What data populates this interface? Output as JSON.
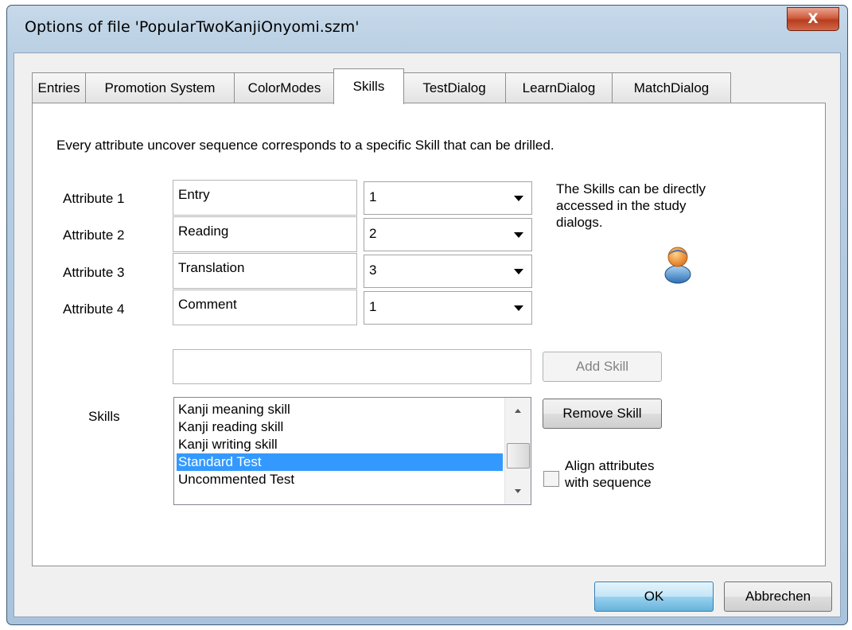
{
  "window": {
    "title": "Options of file 'PopularTwoKanjiOnyomi.szm'",
    "close_symbol": "X"
  },
  "tabs": [
    {
      "label": "Entries"
    },
    {
      "label": "Promotion System"
    },
    {
      "label": "ColorModes"
    },
    {
      "label": "Skills",
      "active": true
    },
    {
      "label": "TestDialog"
    },
    {
      "label": "LearnDialog"
    },
    {
      "label": "MatchDialog"
    }
  ],
  "skills_tab": {
    "intro": "Every attribute uncover sequence corresponds to a specific Skill that can be drilled.",
    "attributes": [
      {
        "label": "Attribute 1",
        "name": "Entry",
        "sequence": "1"
      },
      {
        "label": "Attribute 2",
        "name": "Reading",
        "sequence": "2"
      },
      {
        "label": "Attribute 3",
        "name": "Translation",
        "sequence": "3"
      },
      {
        "label": "Attribute 4",
        "name": "Comment",
        "sequence": "1"
      }
    ],
    "info_line1": "The Skills can be directly",
    "info_line2": "accessed in the study",
    "info_line3": "dialogs.",
    "new_skill_value": "",
    "add_skill_label": "Add Skill",
    "skills_label": "Skills",
    "skills_list": [
      "Kanji meaning skill",
      "Kanji reading skill",
      "Kanji writing skill",
      "Standard Test",
      "Uncommented Test"
    ],
    "selected_skill": "Standard Test",
    "remove_skill_label": "Remove Skill",
    "align_line1": "Align attributes",
    "align_line2": "with sequence",
    "align_checked": false
  },
  "footer": {
    "ok_label": "OK",
    "cancel_label": "Abbrechen"
  },
  "icons": {
    "title_close": "close-icon",
    "info": "user-icon",
    "combo_arrow": "chevron-down-icon"
  },
  "colors": {
    "selection": "#3399ff",
    "close_button": "#c8502f",
    "default_button": "#98d1ef"
  }
}
